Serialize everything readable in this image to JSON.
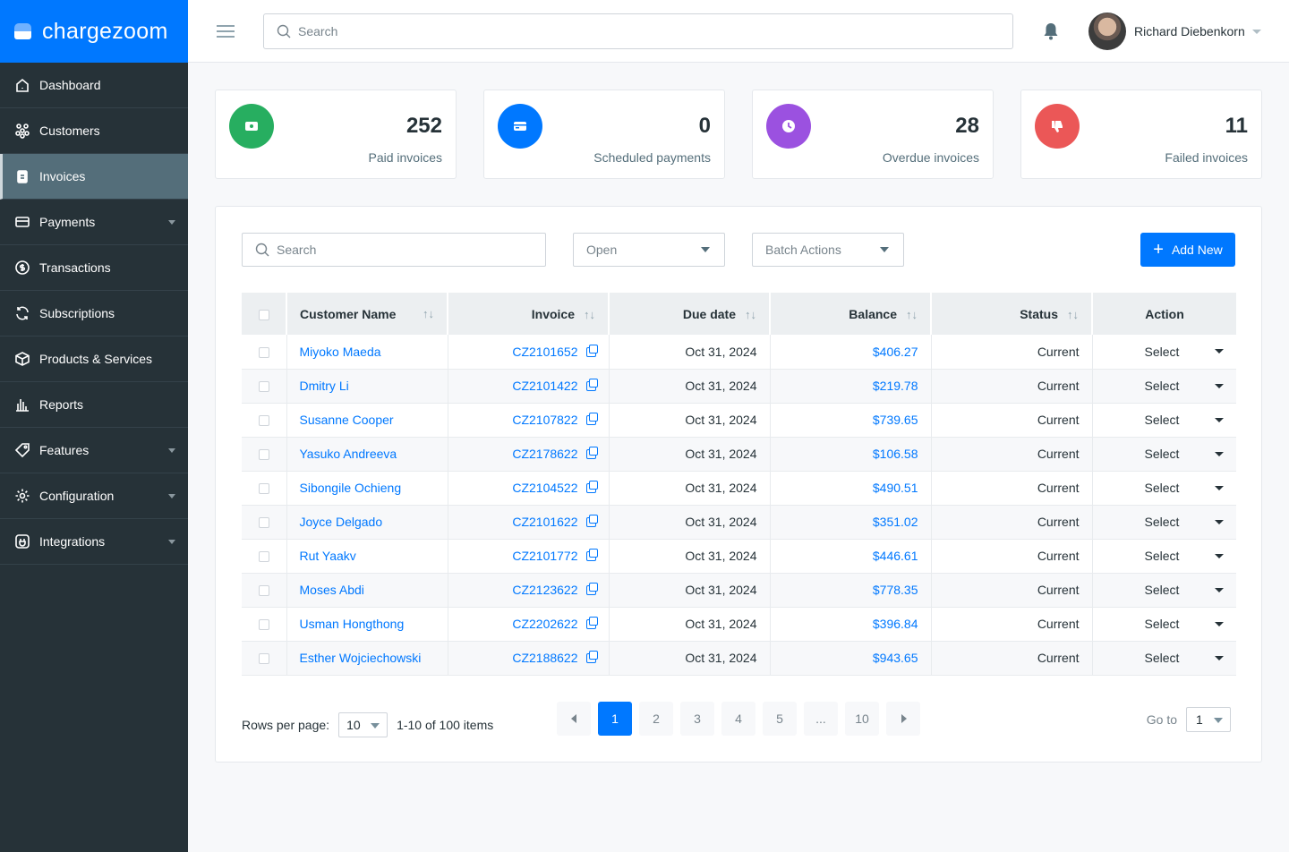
{
  "brand": "chargezoom",
  "sidebar": {
    "items": [
      {
        "label": "Dashboard",
        "icon": "home-icon"
      },
      {
        "label": "Customers",
        "icon": "users-icon"
      },
      {
        "label": "Invoices",
        "icon": "clipboard-icon",
        "active": true
      },
      {
        "label": "Payments",
        "icon": "card-icon",
        "caret": true
      },
      {
        "label": "Transactions",
        "icon": "dollar-icon"
      },
      {
        "label": "Subscriptions",
        "icon": "refresh-icon"
      },
      {
        "label": "Products & Services",
        "icon": "box-icon"
      },
      {
        "label": "Reports",
        "icon": "bar-chart-icon"
      },
      {
        "label": "Features",
        "icon": "tag-icon",
        "caret": true
      },
      {
        "label": "Configuration",
        "icon": "gear-icon",
        "caret": true
      },
      {
        "label": "Integrations",
        "icon": "plug-icon",
        "caret": true
      }
    ]
  },
  "header": {
    "search_placeholder": "Search",
    "user_name": "Richard Diebenkorn"
  },
  "stats": [
    {
      "value": "252",
      "label": "Paid invoices",
      "color": "#27ae60",
      "icon": "cash-icon"
    },
    {
      "value": "0",
      "label": "Scheduled payments",
      "color": "#0078ff",
      "icon": "card-icon"
    },
    {
      "value": "28",
      "label": "Overdue invoices",
      "color": "#9b51e0",
      "icon": "clock-icon"
    },
    {
      "value": "11",
      "label": "Failed invoices",
      "color": "#eb5757",
      "icon": "thumbs-down-icon"
    }
  ],
  "toolbar": {
    "search_placeholder": "Search",
    "status_filter": "Open",
    "batch_actions": "Batch Actions",
    "add_new": "Add New"
  },
  "table": {
    "columns": [
      "Customer Name",
      "Invoice",
      "Due date",
      "Balance",
      "Status",
      "Action"
    ],
    "rows": [
      {
        "name": "Miyoko Maeda",
        "invoice": "CZ2101652",
        "due": "Oct 31, 2024",
        "balance": "$406.27",
        "status": "Current",
        "action": "Select"
      },
      {
        "name": "Dmitry Li",
        "invoice": "CZ2101422",
        "due": "Oct 31, 2024",
        "balance": "$219.78",
        "status": "Current",
        "action": "Select"
      },
      {
        "name": "Susanne Cooper",
        "invoice": "CZ2107822",
        "due": "Oct 31, 2024",
        "balance": "$739.65",
        "status": "Current",
        "action": "Select"
      },
      {
        "name": "Yasuko Andreeva",
        "invoice": "CZ2178622",
        "due": "Oct 31, 2024",
        "balance": "$106.58",
        "status": "Current",
        "action": "Select"
      },
      {
        "name": "Sibongile Ochieng",
        "invoice": "CZ2104522",
        "due": "Oct 31, 2024",
        "balance": "$490.51",
        "status": "Current",
        "action": "Select"
      },
      {
        "name": "Joyce Delgado",
        "invoice": "CZ2101622",
        "due": "Oct 31, 2024",
        "balance": "$351.02",
        "status": "Current",
        "action": "Select"
      },
      {
        "name": "Rut Yaakv",
        "invoice": "CZ2101772",
        "due": "Oct 31, 2024",
        "balance": "$446.61",
        "status": "Current",
        "action": "Select"
      },
      {
        "name": "Moses Abdi",
        "invoice": "CZ2123622",
        "due": "Oct 31, 2024",
        "balance": "$778.35",
        "status": "Current",
        "action": "Select"
      },
      {
        "name": "Usman Hongthong",
        "invoice": "CZ2202622",
        "due": "Oct 31, 2024",
        "balance": "$396.84",
        "status": "Current",
        "action": "Select"
      },
      {
        "name": "Esther Wojciechowski",
        "invoice": "CZ2188622",
        "due": "Oct 31, 2024",
        "balance": "$943.65",
        "status": "Current",
        "action": "Select"
      }
    ]
  },
  "pagination": {
    "rows_per_page_label": "Rows per page:",
    "rows_per_page": "10",
    "range": "1-10 of 100 items",
    "pages": [
      "1",
      "2",
      "3",
      "4",
      "5",
      "...",
      "10"
    ],
    "current": "1",
    "goto_label": "Go to",
    "goto_value": "1"
  }
}
